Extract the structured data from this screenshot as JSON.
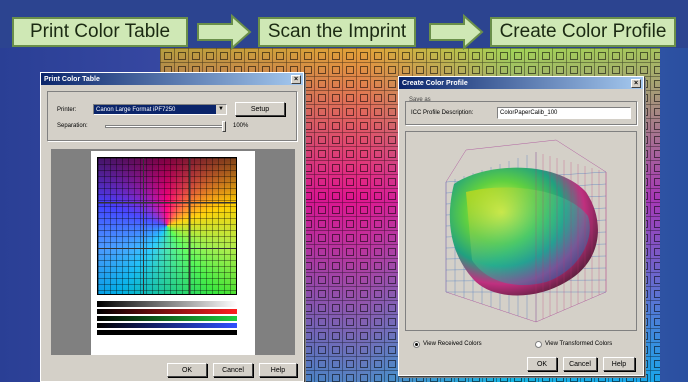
{
  "steps": [
    {
      "label": "Print Color Table"
    },
    {
      "label": "Scan the Imprint"
    },
    {
      "label": "Create Color Profile"
    }
  ],
  "print_window": {
    "title": "Print Color Table",
    "printer_label": "Printer:",
    "printer_value": "Canon Large Format iPF7250",
    "setup_label": "Setup",
    "separation_label": "Separation:",
    "separation_value": "100%",
    "ok_label": "OK",
    "cancel_label": "Cancel",
    "help_label": "Help"
  },
  "profile_window": {
    "title": "Create Color Profile",
    "save_as_label": "Save as",
    "description_label": "ICC Profile Description:",
    "description_value": "ColorPaperCalib_100",
    "view_received_label": "View Received Colors",
    "view_transformed_label": "View Transformed Colors",
    "ok_label": "OK",
    "cancel_label": "Cancel",
    "help_label": "Help"
  },
  "colors": {
    "step_bg": "#cfe8b5",
    "step_border": "#6a8f4a",
    "titlebar": "#0a246a"
  }
}
